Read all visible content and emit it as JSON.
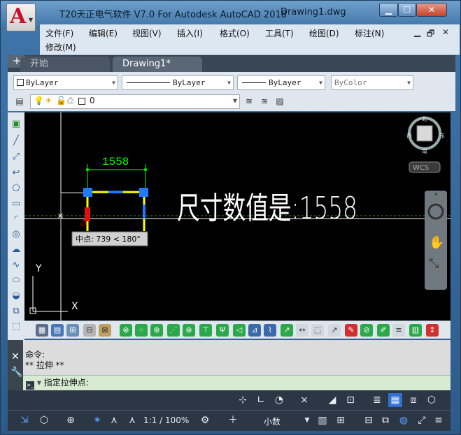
{
  "window": {
    "title": "T20天正电气软件 V7.0 For Autodesk AutoCAD 2018",
    "document_title": "Drawing1.dwg",
    "minimize": "▁",
    "maximize": "☐",
    "close": "✕",
    "app_logo": "A"
  },
  "menu": {
    "items": [
      "文件(F)",
      "编辑(E)",
      "视图(V)",
      "插入(I)",
      "格式(O)",
      "工具(T)",
      "绘图(D)",
      "标注(N)"
    ],
    "row2": [
      "修改(M)"
    ],
    "doc_controls": [
      "▁",
      "🗗",
      "✕"
    ]
  },
  "tabs": {
    "start": "开始",
    "drawing": "Drawing1*",
    "add": "+"
  },
  "properties": {
    "color": "ByLayer",
    "linetype": "ByLayer",
    "lineweight": "ByLayer",
    "plotstyle": "ByColor"
  },
  "layer": {
    "current": "0"
  },
  "canvas": {
    "dimension_value": "1558",
    "dimension_prompt": "尺寸数值是:1558",
    "tooltip": "中点: 739 < 180°",
    "viewcube": {
      "north": "北",
      "south": "南",
      "west": "西",
      "east": "东",
      "wcs": "WCS"
    },
    "ucs_y": "Y",
    "ucs_x": "X",
    "colors": {
      "background": "#000000",
      "dimension": "#00ff00",
      "geometry": "#ffff00",
      "grip": "#1e7bff",
      "selected_grip": "#e01010",
      "text": "#ffffff"
    }
  },
  "command": {
    "history": [
      "命令:",
      "** 拉伸 **"
    ],
    "prompt": "指定拉伸点:"
  },
  "status": {
    "scale": "1:1 / 100%",
    "units": "小数"
  }
}
